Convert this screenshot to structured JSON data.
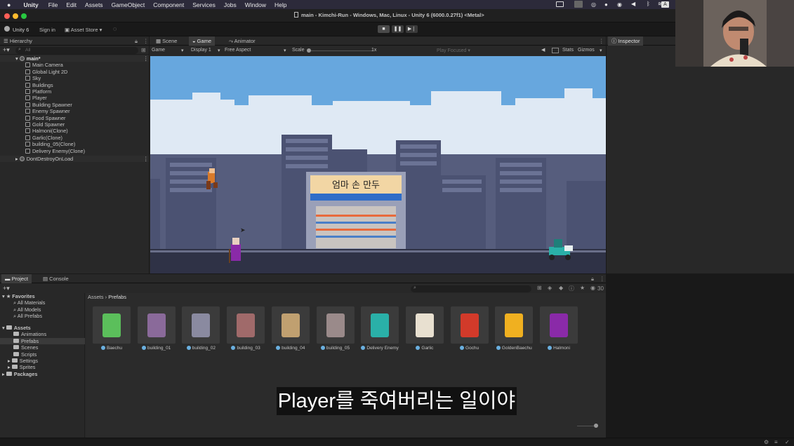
{
  "menubar": {
    "app_name": "Unity",
    "items": [
      "File",
      "Edit",
      "Assets",
      "GameObject",
      "Component",
      "Services",
      "Jobs",
      "Window",
      "Help"
    ]
  },
  "window": {
    "title": "main - Kimchi-Run - Windows, Mac, Linux - Unity 6 (6000.0.27f1) <Metal>"
  },
  "toolbar": {
    "account": "Unity 6",
    "sign_in": "Sign in",
    "asset_store": "Asset Store"
  },
  "hierarchy": {
    "tab": "Hierarchy",
    "search_placeholder": "All",
    "scene": "main*",
    "items": [
      "Main Camera",
      "Global Light 2D",
      "Sky",
      "Buildings",
      "Platform",
      "Player",
      "Building Spawner",
      "Enemy Spawner",
      "Food Spawner",
      "Gold Spawner",
      "Halmoni(Clone)",
      "Garlic(Clone)",
      "building_05(Clone)",
      "Delivery Enemy(Clone)"
    ],
    "dont_destroy": "DontDestroyOnLoad"
  },
  "game_view": {
    "tabs": [
      "Scene",
      "Game",
      "Animator"
    ],
    "mode": "Game",
    "display": "Display 1",
    "aspect": "Free Aspect",
    "scale_label": "Scale",
    "scale_value": "1x",
    "play_focused": "Play Focused",
    "stats": "Stats",
    "gizmos": "Gizmos",
    "sign_text": "엄마 손 만두"
  },
  "inspector": {
    "tab": "Inspector"
  },
  "project": {
    "tabs": [
      "Project",
      "Console"
    ],
    "breadcrumb": [
      "Assets",
      "Prefabs"
    ],
    "count": "30",
    "favorites": {
      "label": "Favorites",
      "items": [
        "All Materials",
        "All Models",
        "All Prefabs"
      ]
    },
    "assets": {
      "label": "Assets",
      "items": [
        "Animations",
        "Prefabs",
        "Scenes",
        "Scripts",
        "Settings",
        "Sprites"
      ]
    },
    "packages": "Packages",
    "prefabs": [
      "Baechu",
      "building_01",
      "building_02",
      "building_03",
      "building_04",
      "building_05",
      "Delivery Enemy",
      "Garlic",
      "Gochu",
      "GoldenBaechu",
      "Halmoni"
    ]
  },
  "subtitle": "Player를 죽여버리는 일이야",
  "colors": {
    "sky": "#67a7de",
    "building": "#4b5272",
    "ground": "#2f3246",
    "menubar": "#2c2a3a"
  }
}
